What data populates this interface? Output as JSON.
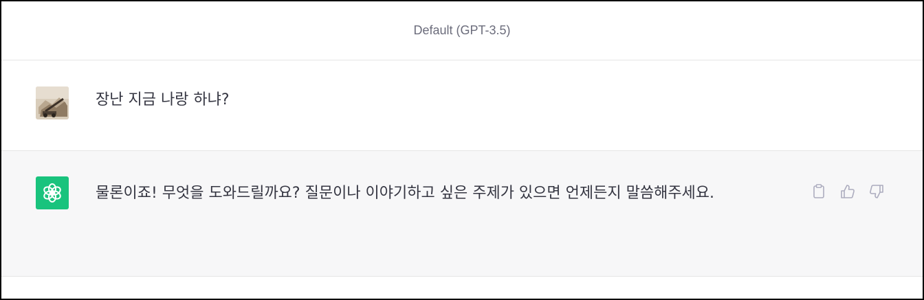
{
  "header": {
    "model_label": "Default (GPT-3.5)"
  },
  "messages": {
    "user": {
      "text": "장난 지금 나랑 하냐?",
      "avatar_icon": "user-photo-avatar"
    },
    "assistant": {
      "text": "물론이죠! 무엇을 도와드릴까요? 질문이나 이야기하고 싶은 주제가 있으면 언제든지 말씀해주세요.",
      "avatar_icon": "openai-logo-icon",
      "actions": [
        "copy-icon",
        "thumbs-up-icon",
        "thumbs-down-icon"
      ]
    }
  },
  "colors": {
    "assistant_avatar_bg": "#19c37d",
    "assistant_row_bg": "#f7f7f8",
    "text": "#343541",
    "muted": "#6b6c7b"
  }
}
